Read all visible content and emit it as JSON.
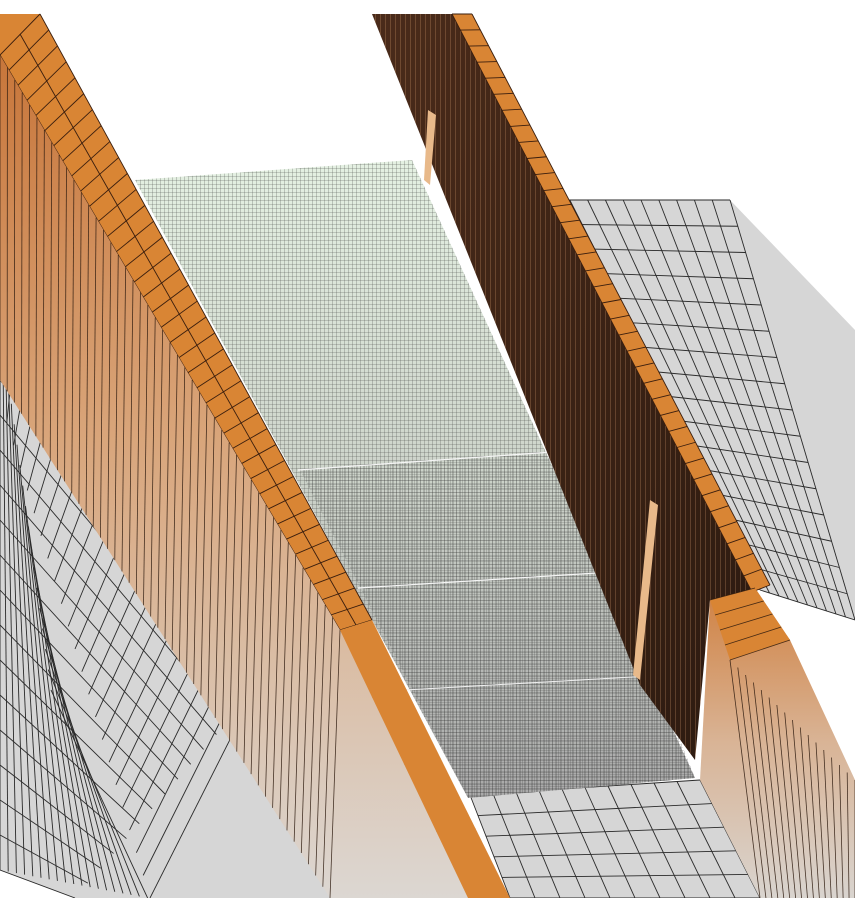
{
  "view": {
    "background": "#ffffff",
    "projection": "perspective"
  },
  "colors": {
    "ground_fill": "#d7d7d7",
    "ground_line": "#2a2a2a",
    "wall_top_fill": "#d98534",
    "wall_face_top": "#c0753a",
    "wall_face_bottom": "#d8d4d0",
    "wall_inner_dark": "#6b3b24",
    "wall_inner_shadow": "#3a2418",
    "floor_near": "#b2b2b2",
    "floor_mid": "#c4c8c2",
    "floor_far": "#ddeedd",
    "floor_line": "#1a1a1a",
    "strip_highlight": "#e8b98a"
  },
  "scene": {
    "objects": [
      {
        "name": "ground-plane-left",
        "kind": "coarse-mesh"
      },
      {
        "name": "ground-plane-right",
        "kind": "coarse-mesh"
      },
      {
        "name": "left-retaining-wall",
        "kind": "hex-mesh-solid"
      },
      {
        "name": "right-retaining-wall",
        "kind": "hex-mesh-solid"
      },
      {
        "name": "channel-floor",
        "kind": "fine-mesh",
        "segments": 3
      }
    ]
  }
}
